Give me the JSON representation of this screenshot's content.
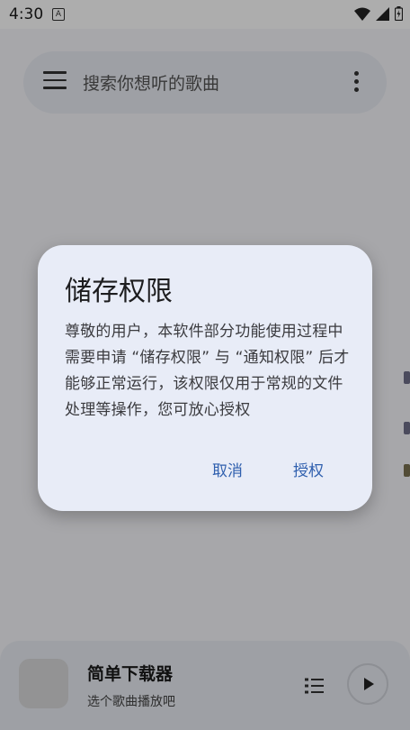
{
  "status_bar": {
    "time": "4:30",
    "notification_icon": "A"
  },
  "search": {
    "placeholder": "搜索你想听的歌曲",
    "menu_icon": "menu-icon",
    "more_icon": "more-vert-icon"
  },
  "player": {
    "title": "简单下载器",
    "subtitle": "选个歌曲播放吧",
    "playlist_icon": "playlist-icon",
    "play_icon": "play-icon"
  },
  "dialog": {
    "title": "储存权限",
    "body": "尊敬的用户，本软件部分功能使用过程中需要申请 “储存权限” 与 “通知权限” 后才能够正常运行，该权限仅用于常规的文件处理等操作，您可放心授权",
    "cancel_label": "取消",
    "grant_label": "授权"
  },
  "colors": {
    "accent": "#2f5fae",
    "dialog_bg": "#e8ecf7",
    "surface": "#e9ecf3"
  }
}
